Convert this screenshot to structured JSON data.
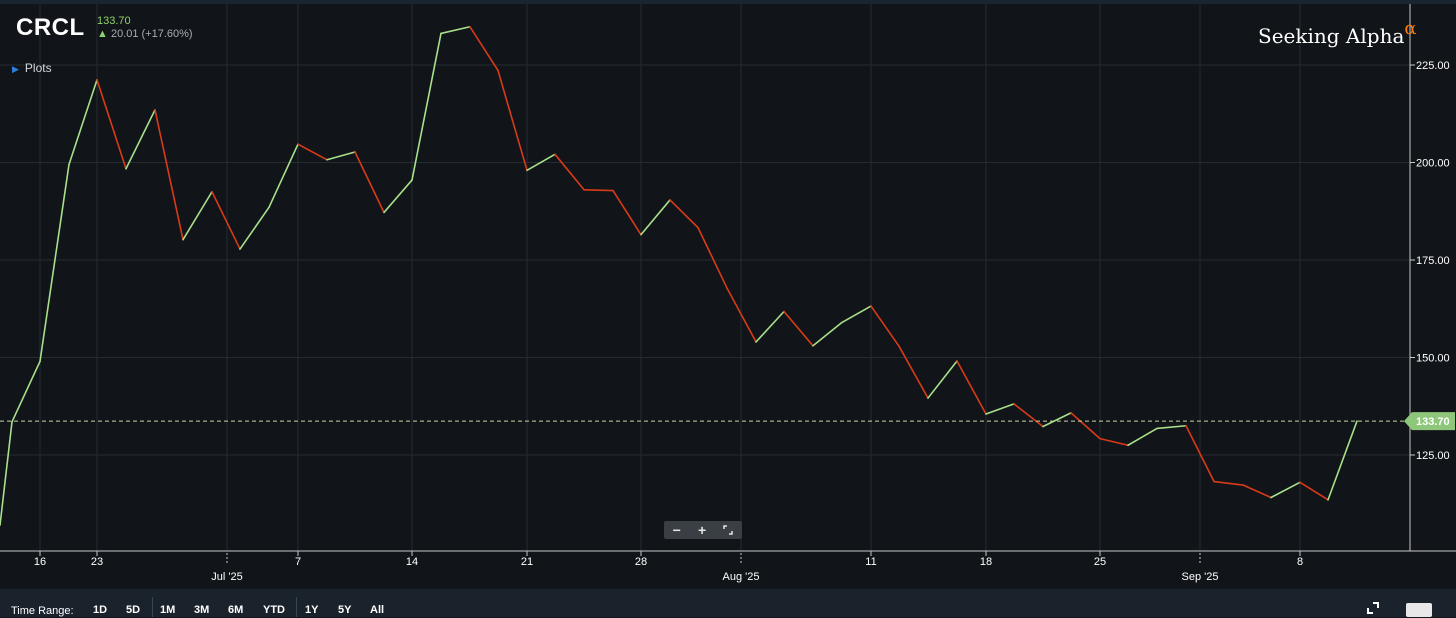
{
  "quote": {
    "ticker": "CRCL",
    "price": "133.70",
    "change": "20.01 (+17.60%)",
    "up_arrow_icon": "arrow-up-icon"
  },
  "plots_label": "Plots",
  "brand": {
    "name": "Seeking Alpha",
    "alpha": "α"
  },
  "zoom": {
    "minus": "−",
    "plus": "+",
    "reset_icon": "expand-arrows-icon"
  },
  "time_range": {
    "label": "Time Range:",
    "buttons": [
      "1D",
      "5D",
      "1M",
      "3M",
      "6M",
      "YTD",
      "1Y",
      "5Y",
      "All"
    ]
  },
  "colors": {
    "up": "#a8e08a",
    "down": "#d93a17",
    "background": "#11151a",
    "grid": "#1f2a30"
  },
  "chart_data": {
    "type": "line",
    "y_ticks": [
      "125.00",
      "150.00",
      "175.00",
      "200.00",
      "225.00"
    ],
    "ylim": [
      100,
      237
    ],
    "x_ticks": [
      "16",
      "23",
      "Jul '25",
      "7",
      "14",
      "21",
      "28",
      "Aug '25",
      "11",
      "18",
      "25",
      "Sep '25",
      "8"
    ],
    "last_price_label": "133.70",
    "last_price": 133.7,
    "grid": true,
    "x": [
      "2025-06-13",
      "2025-06-16",
      "2025-06-18",
      "2025-06-20",
      "2025-06-23",
      "2025-06-24",
      "2025-06-25",
      "2025-06-26",
      "2025-06-27",
      "2025-06-30",
      "2025-07-01",
      "2025-07-02",
      "2025-07-03",
      "2025-07-07",
      "2025-07-08",
      "2025-07-09",
      "2025-07-10",
      "2025-07-11",
      "2025-07-14",
      "2025-07-15",
      "2025-07-16",
      "2025-07-17",
      "2025-07-18",
      "2025-07-21",
      "2025-07-22",
      "2025-07-23",
      "2025-07-24",
      "2025-07-25",
      "2025-07-28",
      "2025-07-29",
      "2025-07-30",
      "2025-07-31",
      "2025-08-01",
      "2025-08-04",
      "2025-08-05",
      "2025-08-06",
      "2025-08-07",
      "2025-08-08",
      "2025-08-11",
      "2025-08-12",
      "2025-08-13",
      "2025-08-14",
      "2025-08-15",
      "2025-08-18",
      "2025-08-19",
      "2025-08-20",
      "2025-08-21",
      "2025-08-22",
      "2025-08-25",
      "2025-08-26",
      "2025-08-27",
      "2025-08-28",
      "2025-08-29",
      "2025-09-02",
      "2025-09-03",
      "2025-09-04",
      "2025-09-05",
      "2025-09-08",
      "2025-09-09",
      "2025-09-10"
    ],
    "values": [
      107,
      133.5,
      149,
      199.5,
      221.2,
      198.4,
      213.5,
      180.2,
      192.5,
      177.8,
      188.5,
      204.7,
      200.7,
      202.7,
      187.2,
      195.5,
      233.1,
      234.8,
      223.6,
      198,
      202.1,
      193,
      192.8,
      181.5,
      190.4,
      183.3,
      167.8,
      154,
      161.8,
      153,
      159,
      163.2,
      152.9,
      139.6,
      149.1,
      135.5,
      138.1,
      132.3,
      135.8,
      129.2,
      127.5,
      131.8,
      132.5,
      118.2,
      117.3,
      114.1,
      118,
      113.5,
      133.7
    ],
    "x_used_count_note": ""
  }
}
